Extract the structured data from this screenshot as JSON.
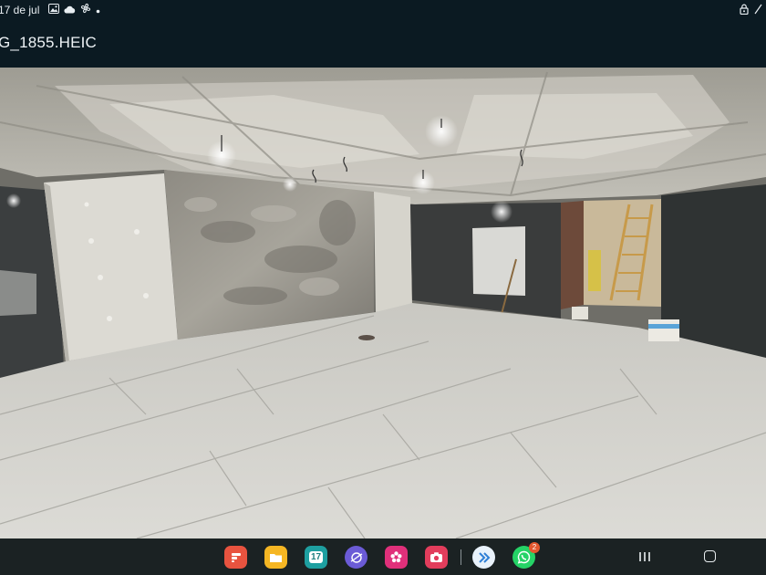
{
  "status": {
    "time_text": "17 de jul"
  },
  "title_bar": {
    "filename": "G_1855.HEIC"
  },
  "taskbar": {
    "apps": [
      {
        "name": "notes-app",
        "color": "#e8533f"
      },
      {
        "name": "files-app",
        "color": "#f5b623"
      },
      {
        "name": "calendar-app",
        "color": "#1e9fa0",
        "label": "17"
      },
      {
        "name": "browser-app",
        "color": "#6b5bd6"
      },
      {
        "name": "blossom-app",
        "color": "#e0307a"
      },
      {
        "name": "camera-app",
        "color": "#e23d5c"
      },
      {
        "name": "forward-app",
        "color": "#e9f2fb"
      },
      {
        "name": "whatsapp-app",
        "color": "#25d366"
      }
    ],
    "calendar_label": "17",
    "whatsapp_badge": "2"
  },
  "colors": {
    "chrome_bg": "#0b1a22",
    "taskbar_bg": "#1b2223"
  }
}
